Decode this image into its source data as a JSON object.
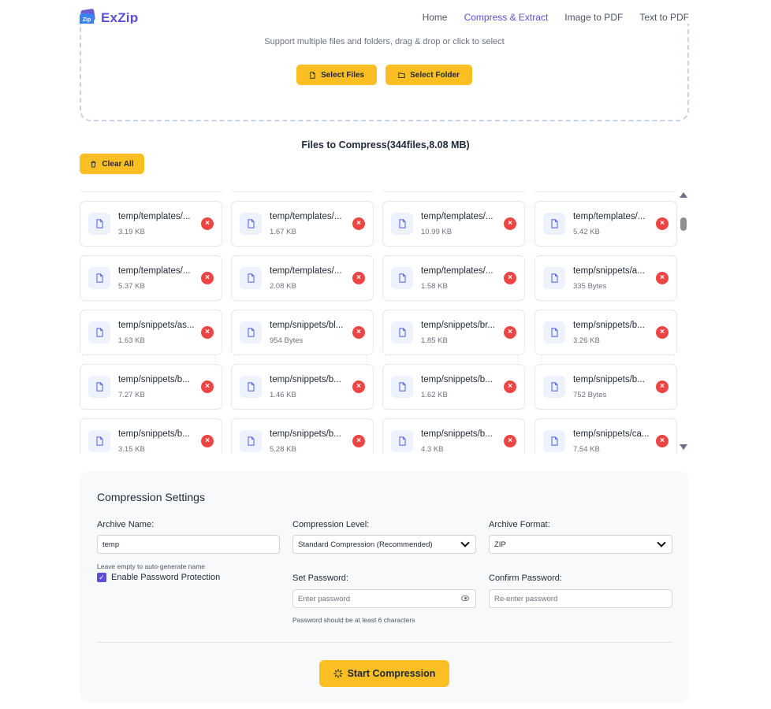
{
  "brand": {
    "name": "ExZip",
    "mark_text": "Zip"
  },
  "nav": [
    {
      "label": "Home",
      "active": false
    },
    {
      "label": "Compress & Extract",
      "active": true
    },
    {
      "label": "Image to PDF",
      "active": false
    },
    {
      "label": "Text to PDF",
      "active": false
    }
  ],
  "dropzone": {
    "hint": "Support multiple files and folders, drag & drop or click to select",
    "select_files_label": "Select Files",
    "select_folder_label": "Select Folder"
  },
  "files": {
    "title": "Files to Compress(344files,8.08 MB)",
    "clear_label": "Clear All",
    "items": [
      {
        "name": "temp/templates/...",
        "size": "3.19 KB"
      },
      {
        "name": "temp/templates/...",
        "size": "1.67 KB"
      },
      {
        "name": "temp/templates/...",
        "size": "10.99 KB"
      },
      {
        "name": "temp/templates/...",
        "size": "5.42 KB"
      },
      {
        "name": "temp/templates/...",
        "size": "5.37 KB"
      },
      {
        "name": "temp/templates/...",
        "size": "2.08 KB"
      },
      {
        "name": "temp/templates/...",
        "size": "1.58 KB"
      },
      {
        "name": "temp/snippets/a...",
        "size": "335 Bytes"
      },
      {
        "name": "temp/snippets/as...",
        "size": "1.63 KB"
      },
      {
        "name": "temp/snippets/bl...",
        "size": "954 Bytes"
      },
      {
        "name": "temp/snippets/br...",
        "size": "1.85 KB"
      },
      {
        "name": "temp/snippets/b...",
        "size": "3.26 KB"
      },
      {
        "name": "temp/snippets/b...",
        "size": "7.27 KB"
      },
      {
        "name": "temp/snippets/b...",
        "size": "1.46 KB"
      },
      {
        "name": "temp/snippets/b...",
        "size": "1.62 KB"
      },
      {
        "name": "temp/snippets/b...",
        "size": "752 Bytes"
      },
      {
        "name": "temp/snippets/b...",
        "size": "3.15 KB"
      },
      {
        "name": "temp/snippets/b...",
        "size": "5.28 KB"
      },
      {
        "name": "temp/snippets/b...",
        "size": "4.3 KB"
      },
      {
        "name": "temp/snippets/ca...",
        "size": "7.54 KB"
      }
    ]
  },
  "settings": {
    "title": "Compression Settings",
    "archive_name_label": "Archive Name:",
    "archive_name_value": "temp",
    "archive_name_hint": "Leave empty to auto-generate name",
    "enable_password_label": "Enable Password Protection",
    "enable_password_checked": true,
    "compression_level_label": "Compression Level:",
    "compression_level_value": "Standard Compression (Recommended)",
    "archive_format_label": "Archive Format:",
    "archive_format_value": "ZIP",
    "set_password_label": "Set Password:",
    "set_password_placeholder": "Enter password",
    "confirm_password_label": "Confirm Password:",
    "confirm_password_placeholder": "Re-enter password",
    "password_hint": "Password should be at least 6 characters",
    "start_label": "Start Compression"
  },
  "colors": {
    "accent": "#5b4fd6",
    "button_yellow": "#fbbf24",
    "delete_red": "#ef4444"
  }
}
